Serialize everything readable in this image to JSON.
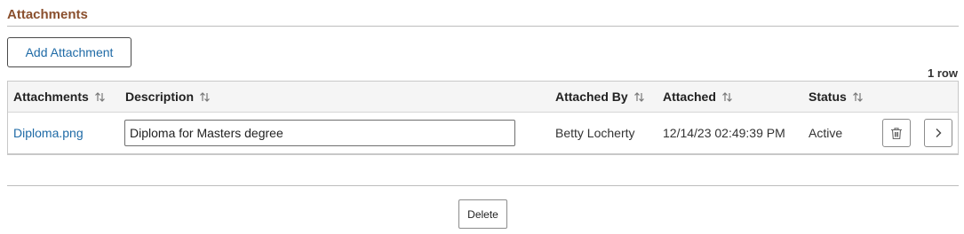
{
  "section": {
    "title": "Attachments"
  },
  "toolbar": {
    "add_label": "Add Attachment"
  },
  "grid": {
    "row_count": "1 row",
    "columns": [
      {
        "label": "Attachments"
      },
      {
        "label": "Description"
      },
      {
        "label": "Attached By"
      },
      {
        "label": "Attached"
      },
      {
        "label": "Status"
      }
    ],
    "rows": [
      {
        "file_name": "Diploma.png",
        "description": "Diploma for Masters degree",
        "attached_by": "Betty Locherty",
        "attached": "12/14/23 02:49:39 PM",
        "status": "Active"
      }
    ]
  },
  "footer": {
    "delete_label": "Delete"
  },
  "colors": {
    "section_title": "#8a4f2d",
    "link": "#1e6aa6",
    "header_bg": "#f5f5f5"
  },
  "icons": {
    "sort": "sort-up-down-icon",
    "delete_row": "trash-icon",
    "row_detail": "chevron-right-icon"
  }
}
